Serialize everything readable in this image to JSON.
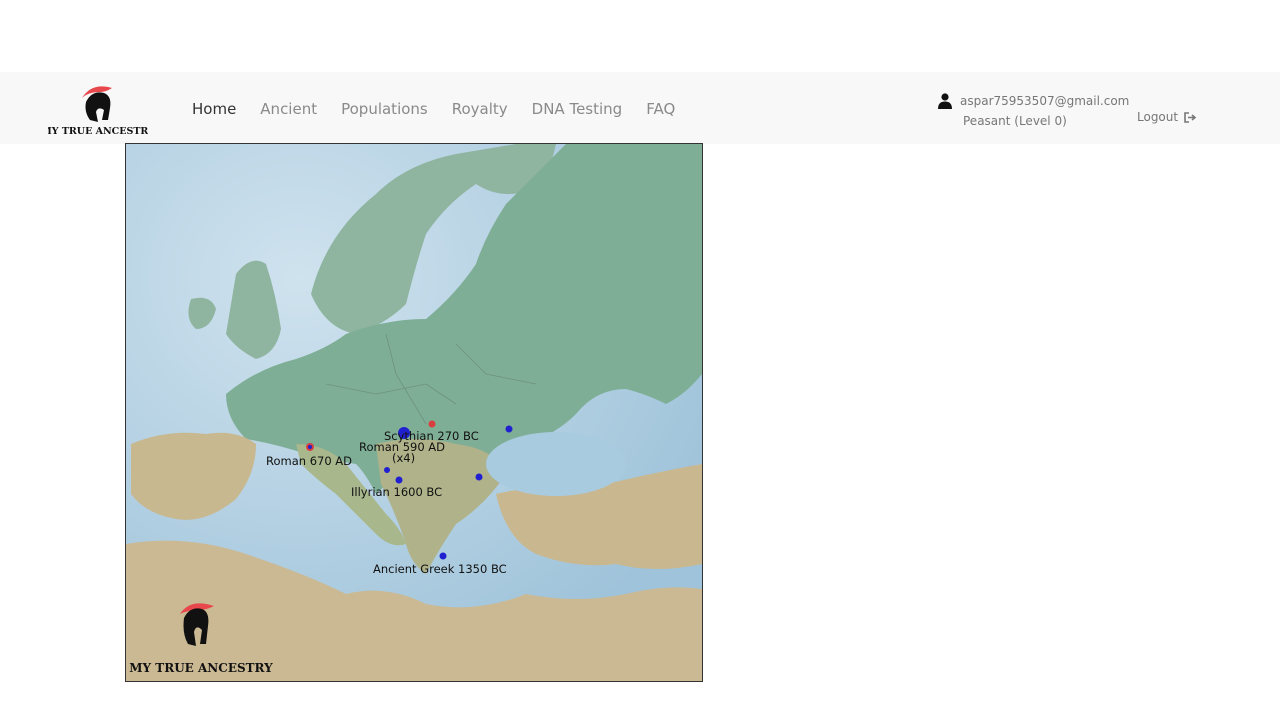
{
  "brand": {
    "name": "MY TRUE ANCESTRY",
    "logo_color": "#e8474b"
  },
  "nav": {
    "items": [
      {
        "label": "Home",
        "active": true
      },
      {
        "label": "Ancient",
        "active": false
      },
      {
        "label": "Populations",
        "active": false
      },
      {
        "label": "Royalty",
        "active": false
      },
      {
        "label": "DNA Testing",
        "active": false
      },
      {
        "label": "FAQ",
        "active": false
      }
    ]
  },
  "user": {
    "email": "aspar75953507@gmail.com",
    "level": "Peasant (Level 0)",
    "logout_label": "Logout"
  },
  "map": {
    "watermark": "MY TRUE ANCESTRY",
    "labels": {
      "roman_670": "Roman 670 AD",
      "scythian_270": "Scythian 270 BC",
      "roman_590": "Roman 590 AD",
      "roman_590_count": "(x4)",
      "illyrian_1600": "Illyrian 1600 BC",
      "greek_1350": "Ancient Greek 1350 BC"
    },
    "colors": {
      "blue_marker": "#2020d0",
      "red_marker": "#d84040"
    }
  }
}
